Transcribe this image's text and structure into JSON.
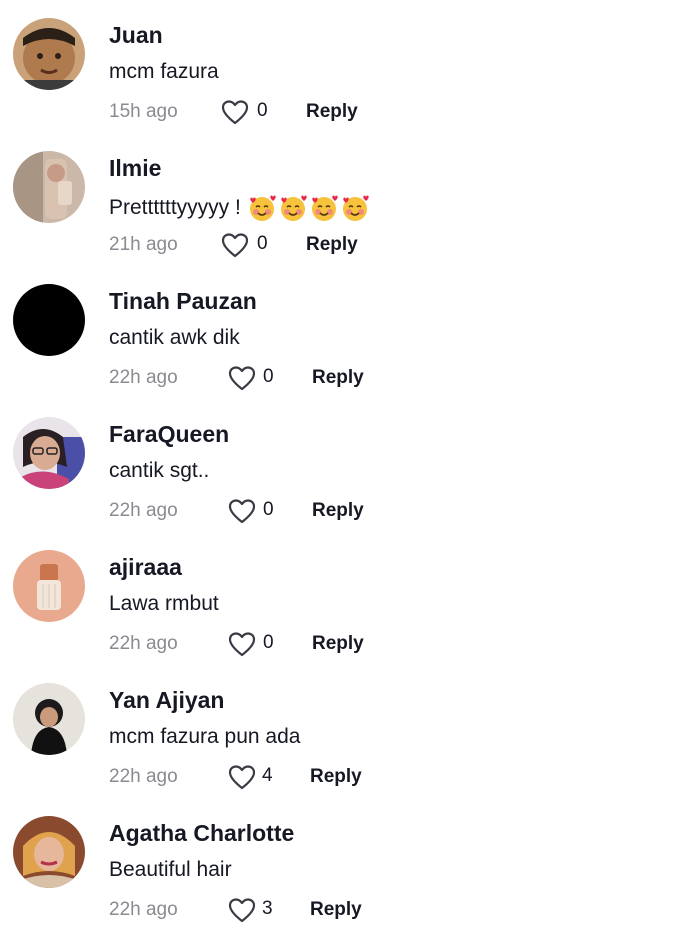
{
  "like_icon": "heart-outline-icon",
  "colors": {
    "text": "#161823",
    "secondary": "#8a8b91",
    "background": "#ffffff"
  },
  "comments": [
    {
      "username": "Juan",
      "text": "mcm fazura",
      "time": "15h ago",
      "likes": "0",
      "reply_label": "Reply"
    },
    {
      "username": "Ilmie",
      "text": "Prettttttyyyyy !",
      "emoji": "smiling-face-with-hearts",
      "time": "21h ago",
      "likes": "0",
      "reply_label": "Reply"
    },
    {
      "username": "Tinah Pauzan",
      "text": "cantik awk dik",
      "time": "22h ago",
      "likes": "0",
      "reply_label": "Reply"
    },
    {
      "username": "FaraQueen",
      "text": "cantik sgt..",
      "time": "22h ago",
      "likes": "0",
      "reply_label": "Reply"
    },
    {
      "username": "ajiraaa",
      "text": "Lawa rmbut",
      "time": "22h ago",
      "likes": "0",
      "reply_label": "Reply"
    },
    {
      "username": "Yan Ajiyan",
      "text": "mcm fazura pun ada",
      "time": "22h ago",
      "likes": "4",
      "reply_label": "Reply"
    },
    {
      "username": "Agatha Charlotte",
      "text": "Beautiful hair",
      "time": "22h ago",
      "likes": "3",
      "reply_label": "Reply"
    }
  ]
}
